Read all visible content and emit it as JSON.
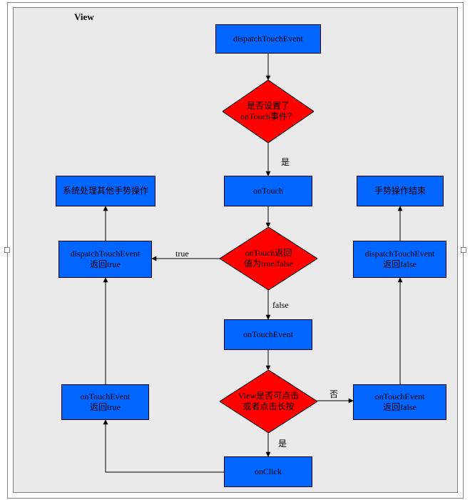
{
  "title": "View",
  "nodes": {
    "dispatch": "dispatchTouchEvent",
    "decisionOnTouchSet": "是否设置了\nonTouch事件？",
    "onTouch": "onTouch",
    "sysGesture": "系统处理其他手势操作",
    "gestureEnd": "手势操作结束",
    "dispatchTrue": "dispatchTouchEvent\n返回true",
    "decisionOnTouchReturn": "onTouch返回\n值为true/false",
    "dispatchFalse": "dispatchTouchEvent\n返回false",
    "onTouchEvent": "onTouchEvent",
    "onTouchEventTrue": "onTouchEvent\n返回true",
    "decisionClickable": "View是否可点击\n或者点击长按",
    "onTouchEventFalse": "onTouchEvent\n返回false",
    "onClick": "onClick"
  },
  "edgeLabels": {
    "yes": "是",
    "true": "true",
    "false": "false",
    "no": "否"
  },
  "chart_data": {
    "type": "flowchart",
    "title": "View",
    "nodes": [
      {
        "id": "dispatch",
        "type": "process",
        "label": "dispatchTouchEvent"
      },
      {
        "id": "decisionOnTouchSet",
        "type": "decision",
        "label": "是否设置了 onTouch事件？"
      },
      {
        "id": "onTouch",
        "type": "process",
        "label": "onTouch"
      },
      {
        "id": "decisionOnTouchReturn",
        "type": "decision",
        "label": "onTouch返回 值为true/false"
      },
      {
        "id": "onTouchEvent",
        "type": "process",
        "label": "onTouchEvent"
      },
      {
        "id": "decisionClickable",
        "type": "decision",
        "label": "View是否可点击 或者点击长按"
      },
      {
        "id": "onClick",
        "type": "process",
        "label": "onClick"
      },
      {
        "id": "dispatchTrue",
        "type": "process",
        "label": "dispatchTouchEvent 返回true"
      },
      {
        "id": "dispatchFalse",
        "type": "process",
        "label": "dispatchTouchEvent 返回false"
      },
      {
        "id": "onTouchEventTrue",
        "type": "process",
        "label": "onTouchEvent 返回true"
      },
      {
        "id": "onTouchEventFalse",
        "type": "process",
        "label": "onTouchEvent 返回false"
      },
      {
        "id": "sysGesture",
        "type": "process",
        "label": "系统处理其他手势操作"
      },
      {
        "id": "gestureEnd",
        "type": "process",
        "label": "手势操作结束"
      }
    ],
    "edges": [
      {
        "from": "dispatch",
        "to": "decisionOnTouchSet"
      },
      {
        "from": "decisionOnTouchSet",
        "to": "onTouch",
        "label": "是"
      },
      {
        "from": "onTouch",
        "to": "decisionOnTouchReturn"
      },
      {
        "from": "decisionOnTouchReturn",
        "to": "dispatchTrue",
        "label": "true"
      },
      {
        "from": "decisionOnTouchReturn",
        "to": "onTouchEvent",
        "label": "false"
      },
      {
        "from": "onTouchEvent",
        "to": "decisionClickable"
      },
      {
        "from": "decisionClickable",
        "to": "onTouchEventFalse",
        "label": "否"
      },
      {
        "from": "decisionClickable",
        "to": "onClick",
        "label": "是"
      },
      {
        "from": "onClick",
        "to": "onTouchEventTrue"
      },
      {
        "from": "onTouchEventTrue",
        "to": "dispatchTrue"
      },
      {
        "from": "dispatchTrue",
        "to": "sysGesture"
      },
      {
        "from": "onTouchEventFalse",
        "to": "dispatchFalse"
      },
      {
        "from": "dispatchFalse",
        "to": "gestureEnd"
      }
    ]
  }
}
